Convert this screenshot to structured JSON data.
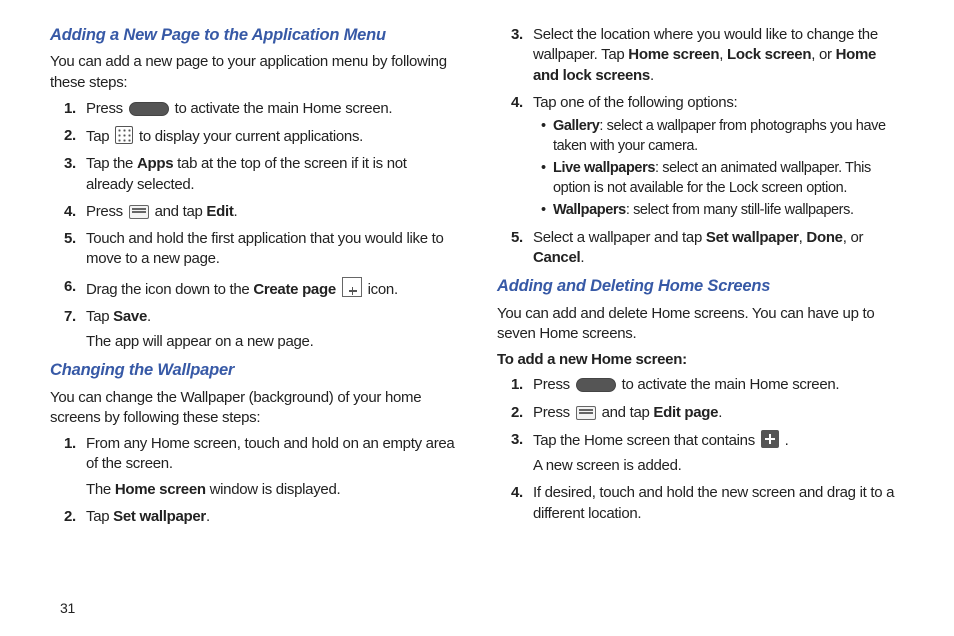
{
  "page_number": "31",
  "left": {
    "section_a": {
      "heading": "Adding a New Page to the Application Menu",
      "intro": "You can add a new page to your application menu by following these steps:",
      "steps": {
        "s1_a": "Press ",
        "s1_b": " to activate the main Home screen.",
        "s2_a": "Tap ",
        "s2_b": " to display your current applications.",
        "s3_a": "Tap the ",
        "s3_bold": "Apps",
        "s3_b": " tab at the top of the screen if it is not already selected.",
        "s4_a": "Press ",
        "s4_b": " and tap ",
        "s4_bold": "Edit",
        "s4_c": ".",
        "s5": "Touch and hold the first application that you would like to move to a new page.",
        "s6_a": "Drag the icon down to the ",
        "s6_bold": "Create page",
        "s6_b": "  icon.",
        "s7_a": "Tap ",
        "s7_bold": "Save",
        "s7_b": ".",
        "s7_sub": "The app will appear on a new page."
      }
    },
    "section_b": {
      "heading": "Changing the Wallpaper",
      "intro": "You can change the Wallpaper (background) of your home screens by following these steps:",
      "steps": {
        "s1": "From any Home screen, touch and hold on an empty area of the screen.",
        "s1_sub_a": "The ",
        "s1_sub_bold": "Home screen",
        "s1_sub_b": " window is displayed.",
        "s2_a": "Tap ",
        "s2_bold": "Set wallpaper",
        "s2_b": "."
      }
    }
  },
  "right": {
    "continued_steps": {
      "s3_a": "Select the location where you would like to change the wallpaper. Tap ",
      "s3_b1": "Home screen",
      "s3_c": ", ",
      "s3_b2": "Lock screen",
      "s3_d": ", or ",
      "s3_b3": "Home and lock screens",
      "s3_e": ".",
      "s4": "Tap one of the following options:",
      "bullets": {
        "b1_bold": "Gallery",
        "b1": ": select a wallpaper from photographs you have taken with your camera.",
        "b2_bold": "Live wallpapers",
        "b2": ": select an animated wallpaper. This option is not available for the Lock screen option.",
        "b3_bold": "Wallpapers",
        "b3": ": select from many still-life wallpapers."
      },
      "s5_a": "Select a wallpaper and tap ",
      "s5_b1": "Set wallpaper",
      "s5_c": ", ",
      "s5_b2": "Done",
      "s5_d": ", or ",
      "s5_b3": "Cancel",
      "s5_e": "."
    },
    "section_c": {
      "heading": "Adding and Deleting Home Screens",
      "intro": "You can add and delete Home screens. You can have up to seven Home screens.",
      "subheading": "To add a new Home screen:",
      "steps": {
        "s1_a": "Press ",
        "s1_b": " to activate the main Home screen.",
        "s2_a": "Press ",
        "s2_b": " and tap ",
        "s2_bold": "Edit page",
        "s2_c": ".",
        "s3_a": "Tap the Home screen that contains ",
        "s3_b": " .",
        "s3_sub": "A new screen is added.",
        "s4": "If desired, touch and hold the new screen and drag it to a different location."
      }
    }
  }
}
